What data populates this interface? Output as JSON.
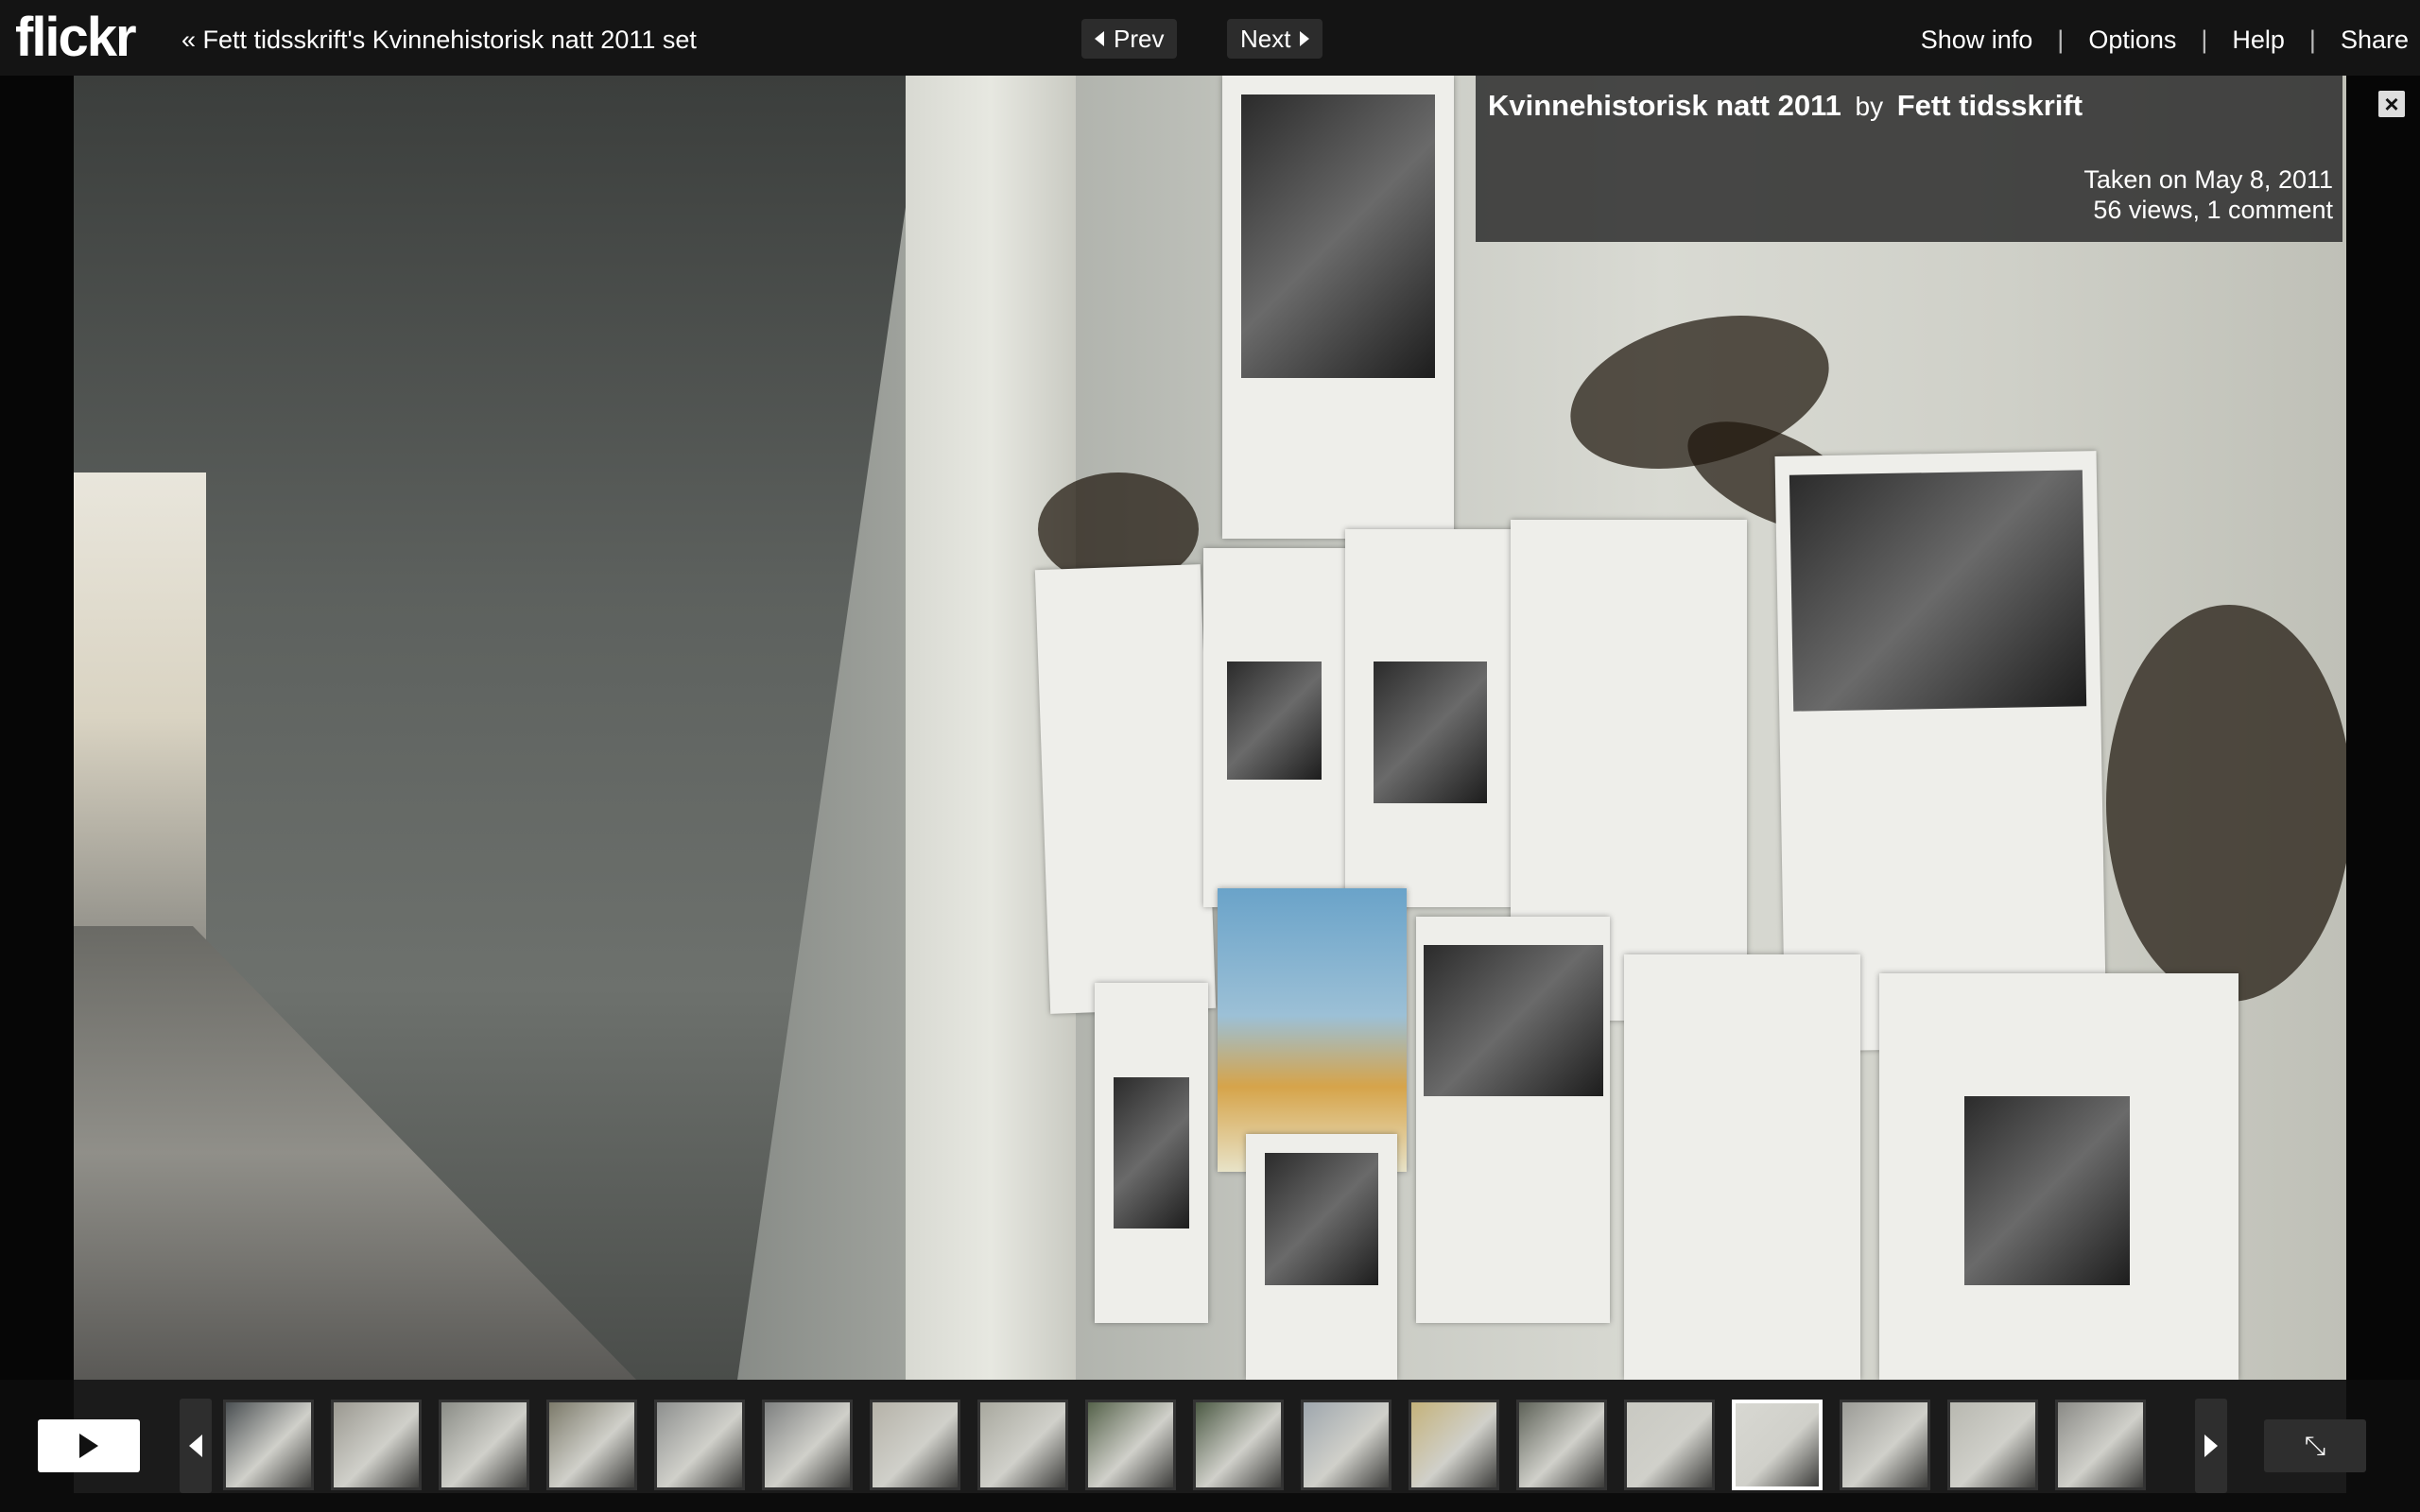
{
  "topbar": {
    "logo_text": "flickr",
    "set_link": "« Fett tidsskrift's Kvinnehistorisk natt 2011 set",
    "prev_label": "Prev",
    "next_label": "Next",
    "menu": [
      "Show info",
      "Options",
      "Help",
      "Share"
    ]
  },
  "info_panel": {
    "title": "Kvinnehistorisk natt 2011",
    "by": "by",
    "author": "Fett tidsskrift",
    "taken": "Taken on May 8, 2011",
    "stats": "56 views, 1 comment",
    "close_icon": "close-icon"
  },
  "filmstrip": {
    "thumb_count": 18,
    "active_index": 14,
    "play_icon": "play-icon",
    "fullscreen_icon": "collapse-fullscreen-icon"
  },
  "colors": {
    "bar_background": "#161616",
    "active_thumb_border": "#ffffff"
  }
}
